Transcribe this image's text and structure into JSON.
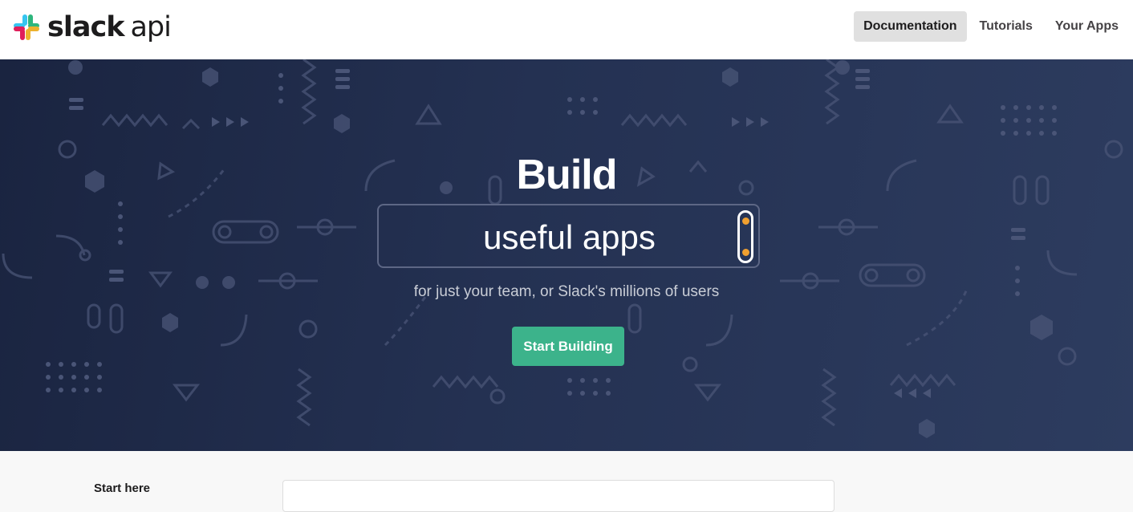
{
  "header": {
    "logo": {
      "wordmark": "slack",
      "suffix": "api",
      "icon": "slack-logo-icon"
    },
    "nav": [
      {
        "label": "Documentation",
        "active": true
      },
      {
        "label": "Tutorials",
        "active": false
      },
      {
        "label": "Your Apps",
        "active": false
      }
    ]
  },
  "hero": {
    "title": "Build",
    "rotator_text": "useful apps",
    "subtitle": "for just your team, or Slack's millions of users",
    "cta_label": "Start Building",
    "colors": {
      "cta": "#3cb38b",
      "background": "#243152",
      "switch_dot": "#f0a030"
    }
  },
  "sidebar": {
    "heading": "Start here"
  }
}
